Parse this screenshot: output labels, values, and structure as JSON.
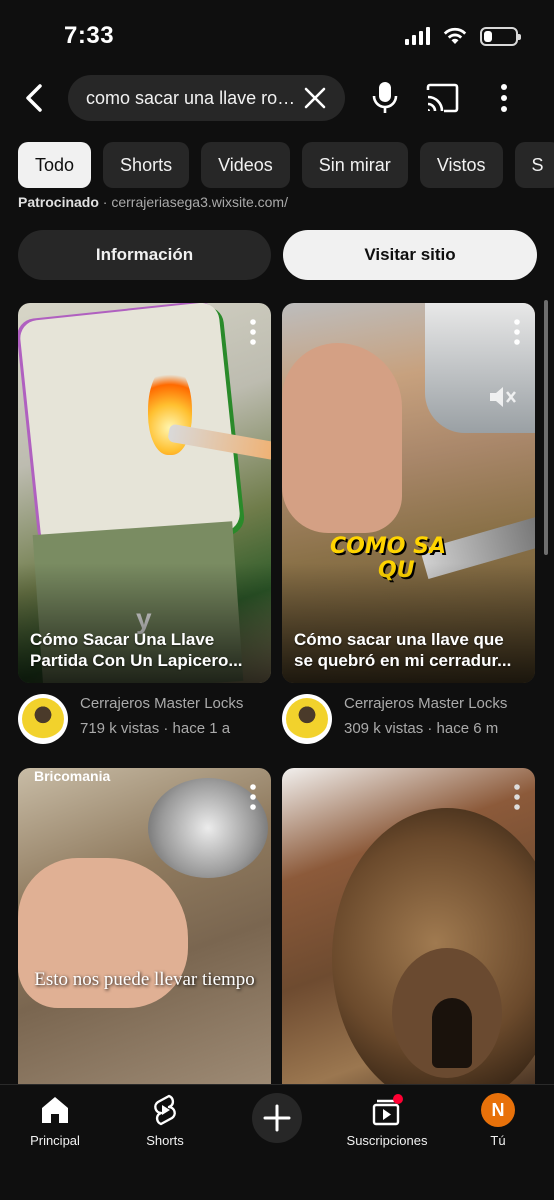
{
  "status_bar": {
    "time": "7:33",
    "battery_level": 0.25
  },
  "search": {
    "query": "como sacar una llave rota..."
  },
  "icons": {
    "back": "back-arrow-icon",
    "clear": "close-icon",
    "mic": "microphone-icon",
    "cast": "cast-icon",
    "more": "more-vertical-icon"
  },
  "filters": [
    "Todo",
    "Shorts",
    "Videos",
    "Sin mirar",
    "Vistos",
    "S"
  ],
  "active_filter": "Todo",
  "sponsored": {
    "label": "Patrocinado",
    "separator": "·",
    "domain": "cerrajeriasega3.wixsite.com/",
    "info_button": "Información",
    "visit_button": "Visitar sitio"
  },
  "shorts": [
    {
      "title": "Cómo Sacar Una Llave Partida Con Un Lapicero...",
      "overlay_text": "y",
      "channel": "Cerrajeros Master Locks",
      "meta": "719 k vistas · hace 1 a"
    },
    {
      "title": "Cómo sacar una llave que se quebró en mi cerradur...",
      "overlay_text_line1": "COMO SA",
      "overlay_text_line2": "QU",
      "channel": "Cerrajeros Master Locks",
      "meta": "309 k vistas · hace 6 m"
    },
    {
      "title": "",
      "channel_watermark": "Bricomania",
      "caption": "Esto nos puede llevar tiempo"
    },
    {
      "title": ""
    }
  ],
  "bottom_nav": [
    {
      "label": "Principal",
      "icon": "home-icon"
    },
    {
      "label": "Shorts",
      "icon": "shorts-icon"
    },
    {
      "label": "",
      "icon": "plus-icon"
    },
    {
      "label": "Suscripciones",
      "icon": "subscriptions-icon"
    },
    {
      "label": "Tú",
      "icon": "profile-avatar",
      "avatar_letter": "N",
      "avatar_color": "#e8710a"
    }
  ],
  "colors": {
    "background": "#0f0f0f",
    "chip": "#272727",
    "chip_active": "#f1f1f1",
    "notification": "#ff0033"
  }
}
